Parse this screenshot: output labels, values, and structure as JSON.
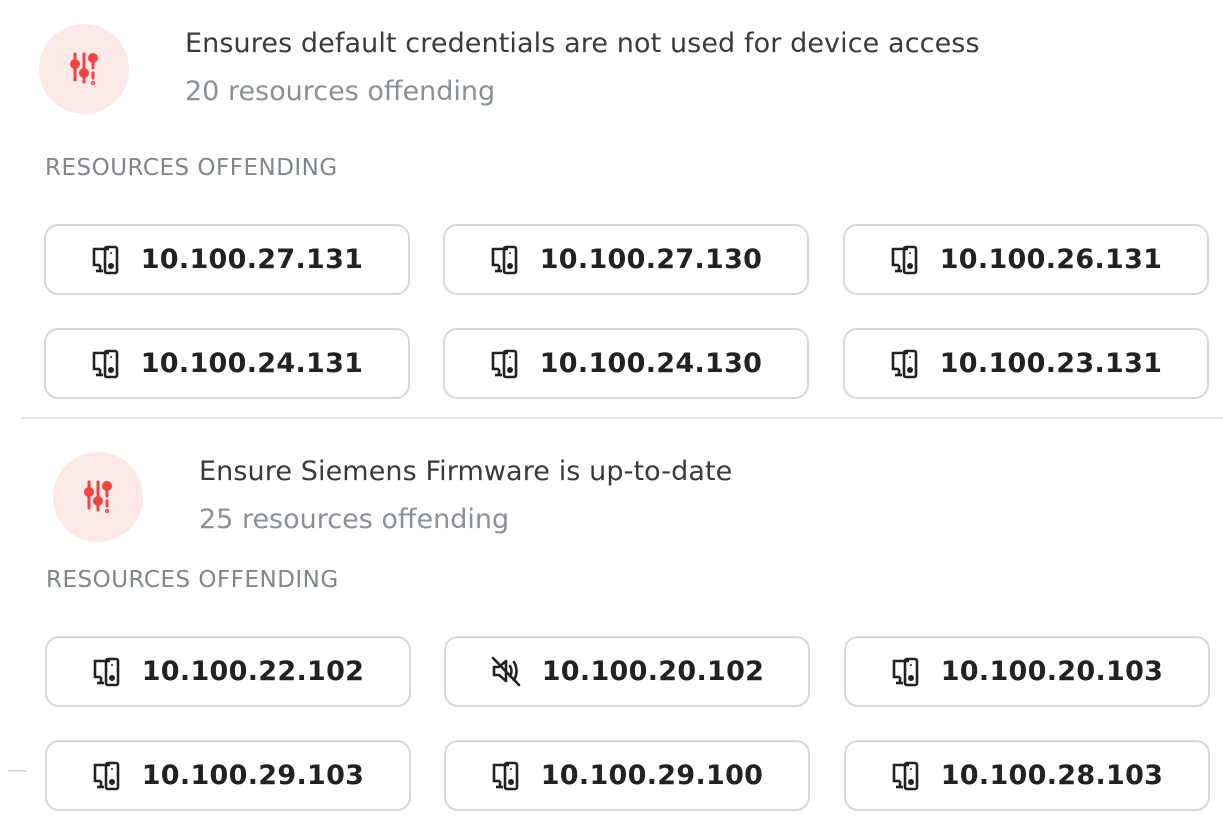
{
  "policies": [
    {
      "icon": "sliders-alert-icon",
      "title": "Ensures default credentials are not used for device access",
      "subtitle": "20 resources offending",
      "resources_label": "RESOURCES OFFENDING",
      "resources": [
        {
          "ip": "10.100.27.131",
          "icon": "devices-icon"
        },
        {
          "ip": "10.100.27.130",
          "icon": "devices-icon"
        },
        {
          "ip": "10.100.26.131",
          "icon": "devices-icon"
        },
        {
          "ip": "10.100.24.131",
          "icon": "devices-icon"
        },
        {
          "ip": "10.100.24.130",
          "icon": "devices-icon"
        },
        {
          "ip": "10.100.23.131",
          "icon": "devices-icon"
        }
      ]
    },
    {
      "icon": "sliders-alert-icon",
      "title": "Ensure Siemens Firmware is up-to-date",
      "subtitle": "25 resources offending",
      "resources_label": "RESOURCES OFFENDING",
      "resources": [
        {
          "ip": "10.100.22.102",
          "icon": "devices-icon"
        },
        {
          "ip": "10.100.20.102",
          "icon": "speaker-muted-icon"
        },
        {
          "ip": "10.100.20.103",
          "icon": "devices-icon"
        },
        {
          "ip": "10.100.29.103",
          "icon": "devices-icon"
        },
        {
          "ip": "10.100.29.100",
          "icon": "devices-icon"
        },
        {
          "ip": "10.100.28.103",
          "icon": "devices-icon"
        }
      ]
    }
  ],
  "colors": {
    "accent_red": "#ef4444",
    "icon_bg": "#fde8e8",
    "muted_text": "#8b9096"
  }
}
